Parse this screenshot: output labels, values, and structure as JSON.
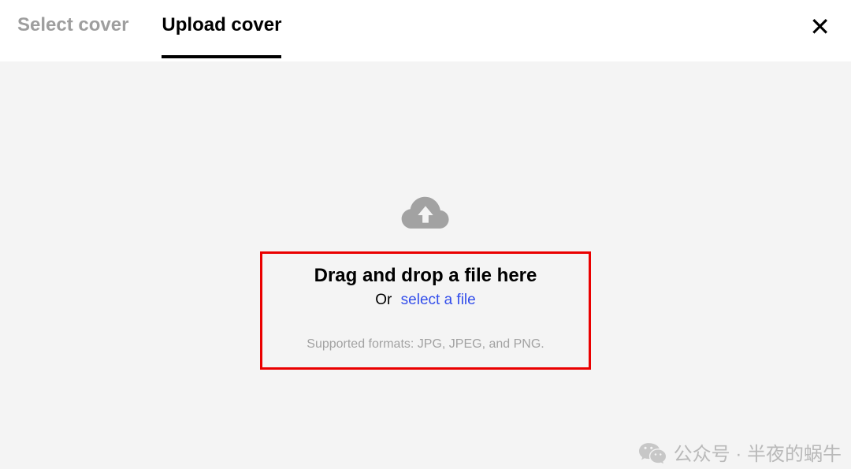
{
  "header": {
    "tabs": {
      "select_cover": "Select cover",
      "upload_cover": "Upload cover"
    },
    "close_label": "✕"
  },
  "upload": {
    "drop_title": "Drag and drop a file here",
    "or_text": "Or",
    "select_link": "select a file",
    "supported": "Supported formats: JPG, JPEG, and PNG."
  },
  "watermark": {
    "text": "公众号 · 半夜的蜗牛"
  }
}
